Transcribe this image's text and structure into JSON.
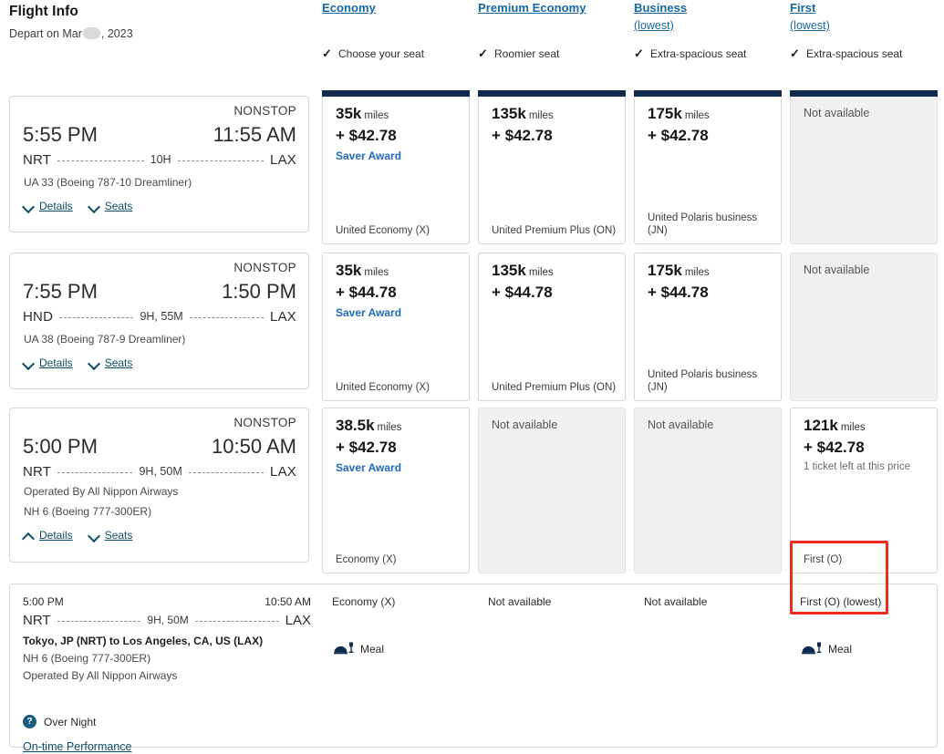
{
  "header": {
    "title": "Flight Info",
    "depart_prefix": "Depart on Mar",
    "depart_suffix": ", 2023",
    "depart_redacted": true
  },
  "fare_columns": [
    {
      "name": "Economy",
      "link": "Economy",
      "lowest": "",
      "feature": "Choose your seat",
      "check": "✓"
    },
    {
      "name": "Premium Economy",
      "link": "Premium Economy",
      "lowest": "",
      "feature": "Roomier seat",
      "check": "✓"
    },
    {
      "name": "Business",
      "link": "Business",
      "lowest": "(lowest)",
      "feature": "Extra-spacious seat",
      "check": "✓"
    },
    {
      "name": "First",
      "link": "First",
      "lowest": "(lowest)",
      "feature": "Extra-spacious seat",
      "check": "✓"
    }
  ],
  "rows": [
    {
      "flight": {
        "stops": "NONSTOP",
        "depart_time": "5:55 PM",
        "arrive_time": "11:55 AM",
        "origin": "NRT",
        "destination": "LAX",
        "duration": "10H",
        "aircraft": "UA 33 (Boeing 787-10 Dreamliner)",
        "operated_by": "",
        "details_label": "Details",
        "details_state": "collapsed",
        "seats_label": "Seats"
      },
      "fares": [
        {
          "available": true,
          "miles": "35k",
          "miles_unit": "miles",
          "cash": "+ $42.78",
          "badge": "Saver Award",
          "note": "",
          "cabin": "United Economy (X)"
        },
        {
          "available": true,
          "miles": "135k",
          "miles_unit": "miles",
          "cash": "+ $42.78",
          "badge": "",
          "note": "",
          "cabin": "United Premium Plus (ON)"
        },
        {
          "available": true,
          "miles": "175k",
          "miles_unit": "miles",
          "cash": "+ $42.78",
          "badge": "",
          "note": "",
          "cabin": "United Polaris business (JN)"
        },
        {
          "available": false,
          "unavailable_label": "Not available"
        }
      ]
    },
    {
      "flight": {
        "stops": "NONSTOP",
        "depart_time": "7:55 PM",
        "arrive_time": "1:50 PM",
        "origin": "HND",
        "destination": "LAX",
        "duration": "9H, 55M",
        "aircraft": "UA 38 (Boeing 787-9 Dreamliner)",
        "operated_by": "",
        "details_label": "Details",
        "details_state": "collapsed",
        "seats_label": "Seats"
      },
      "fares": [
        {
          "available": true,
          "miles": "35k",
          "miles_unit": "miles",
          "cash": "+ $44.78",
          "badge": "Saver Award",
          "note": "",
          "cabin": "United Economy (X)"
        },
        {
          "available": true,
          "miles": "135k",
          "miles_unit": "miles",
          "cash": "+ $44.78",
          "badge": "",
          "note": "",
          "cabin": "United Premium Plus (ON)"
        },
        {
          "available": true,
          "miles": "175k",
          "miles_unit": "miles",
          "cash": "+ $44.78",
          "badge": "",
          "note": "",
          "cabin": "United Polaris business (JN)"
        },
        {
          "available": false,
          "unavailable_label": "Not available"
        }
      ]
    },
    {
      "flight": {
        "stops": "NONSTOP",
        "depart_time": "5:00 PM",
        "arrive_time": "10:50 AM",
        "origin": "NRT",
        "destination": "LAX",
        "duration": "9H, 50M",
        "aircraft": "NH 6 (Boeing 777-300ER)",
        "operated_by": "Operated By All Nippon Airways",
        "details_label": "Details",
        "details_state": "expanded",
        "seats_label": "Seats"
      },
      "fares": [
        {
          "available": true,
          "miles": "38.5k",
          "miles_unit": "miles",
          "cash": "+ $42.78",
          "badge": "Saver Award",
          "note": "",
          "cabin": "Economy (X)"
        },
        {
          "available": false,
          "unavailable_label": "Not available"
        },
        {
          "available": false,
          "unavailable_label": "Not available"
        },
        {
          "available": true,
          "miles": "121k",
          "miles_unit": "miles",
          "cash": "+ $42.78",
          "badge": "",
          "note": "1 ticket left at this price",
          "cabin": "First (O)"
        }
      ]
    }
  ],
  "detail_panel": {
    "depart_time": "5:00 PM",
    "arrive_time": "10:50 AM",
    "origin": "NRT",
    "destination": "LAX",
    "duration": "9H, 50M",
    "city_pair": "Tokyo, JP (NRT) to Los Angeles, CA, US (LAX)",
    "aircraft": "NH 6 (Boeing 777-300ER)",
    "operated_by": "Operated By All Nippon Airways",
    "overnight_label": "Over Night",
    "overnight_icon": "question-icon",
    "on_time_link": "On-time Performance",
    "cabins": [
      {
        "label": "Economy (X)",
        "meal": "Meal"
      },
      {
        "label": "Not available",
        "meal": ""
      },
      {
        "label": "Not available",
        "meal": ""
      },
      {
        "label": "First (O) (lowest)",
        "meal": "Meal"
      }
    ]
  },
  "annotation": {
    "type": "red-highlight-box",
    "color": "#EF2A20"
  },
  "colors": {
    "link_blue": "#1668A3",
    "link_teal": "#0D4D6B",
    "saver_blue": "#2169C0",
    "fare_bar_navy": "#102B4E",
    "unavailable_bg": "#F0F0F0",
    "card_border": "#D6D6D6",
    "annotation_red": "#EF2A20"
  }
}
